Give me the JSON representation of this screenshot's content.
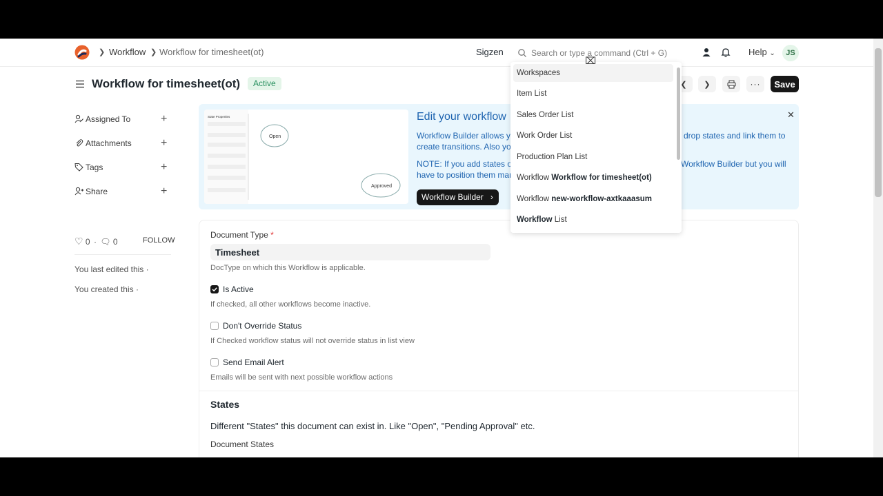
{
  "breadcrumbs": [
    "Workflow",
    "Workflow for timesheet(ot)"
  ],
  "navbar": {
    "company": "Sigzen",
    "search_placeholder": "Search or type a command (Ctrl + G)",
    "help_label": "Help",
    "avatar_initials": "JS"
  },
  "page": {
    "title": "Workflow for timesheet(ot)",
    "status": "Active",
    "save_label": "Save"
  },
  "sidebar": {
    "items": [
      {
        "label": "Assigned To",
        "icon": "user-check-icon"
      },
      {
        "label": "Attachments",
        "icon": "paperclip-icon"
      },
      {
        "label": "Tags",
        "icon": "tag-icon"
      },
      {
        "label": "Share",
        "icon": "share-user-icon"
      }
    ],
    "likes_count": "0",
    "comments_count": "0",
    "follow_label": "FOLLOW",
    "last_edited": "You last edited this ·",
    "created": "You created this ·"
  },
  "banner": {
    "title": "Edit your workflow",
    "line1a": "Workflow Builder allows yo",
    "line1b": "drop states and link them to",
    "line2": "create transitions. Also you",
    "line3a": "NOTE: If you add states or",
    "line3b": "Workflow Builder but you will",
    "line4": "have to position them man",
    "button_label": "Workflow Builder",
    "preview": {
      "panel_title": "State Properties",
      "node_open": "Open",
      "node_approved": "Approved"
    }
  },
  "form": {
    "document_type_label": "Document Type",
    "document_type_value": "Timesheet",
    "document_type_desc": "DocType on which this Workflow is applicable.",
    "is_active_label": "Is Active",
    "is_active_desc": "If checked, all other workflows become inactive.",
    "dont_override_label": "Don't Override Status",
    "dont_override_desc": "If Checked workflow status will not override status in list view",
    "send_email_label": "Send Email Alert",
    "send_email_desc": "Emails will be sent with next possible workflow actions",
    "states_title": "States",
    "states_text": "Different \"States\" this document can exist in. Like \"Open\", \"Pending Approval\" etc.",
    "document_states_label": "Document States"
  },
  "dropdown": {
    "items": [
      {
        "prefix": "Workspaces",
        "bold": ""
      },
      {
        "prefix": "Item List",
        "bold": ""
      },
      {
        "prefix": "Sales Order List",
        "bold": ""
      },
      {
        "prefix": "Work Order List",
        "bold": ""
      },
      {
        "prefix": "Production Plan List",
        "bold": ""
      },
      {
        "prefix": "Workflow ",
        "bold": "Workflow for timesheet(ot)"
      },
      {
        "prefix": "Workflow ",
        "bold": "new-workflow-axtkaaasum"
      },
      {
        "prefix": "",
        "bold": "Workflow",
        "suffix": " List"
      }
    ]
  }
}
